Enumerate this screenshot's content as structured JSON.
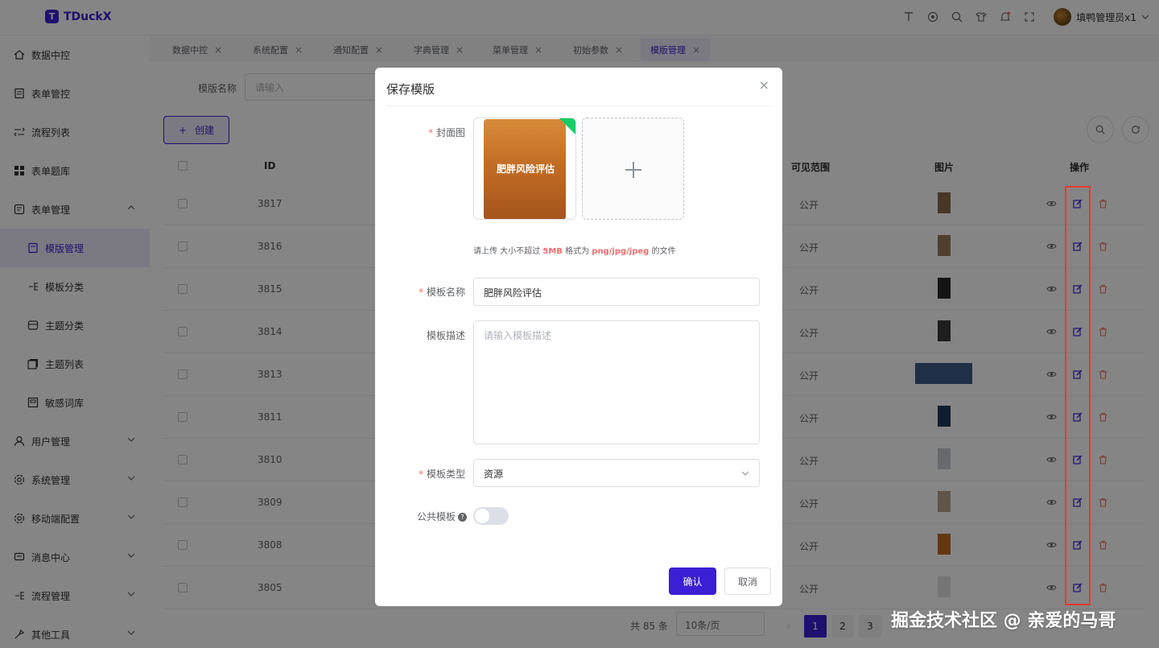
{
  "app": {
    "name": "TDuckX",
    "logo_letter": "T"
  },
  "topbar": {
    "icons": [
      "text-icon",
      "target-icon",
      "search-icon",
      "shirt-icon",
      "bell-icon",
      "fullscreen-icon"
    ],
    "user": "填鸭管理员x1"
  },
  "sidebar": {
    "items": [
      {
        "label": "数据中控",
        "icon": "home-icon"
      },
      {
        "label": "表单管控",
        "icon": "form-icon"
      },
      {
        "label": "流程列表",
        "icon": "flow-icon"
      },
      {
        "label": "表单题库",
        "icon": "grid-icon"
      },
      {
        "label": "表单管理",
        "icon": "form-manage-icon"
      },
      {
        "label": "模版管理",
        "icon": "template-icon"
      },
      {
        "label": "模板分类",
        "icon": "category-icon"
      },
      {
        "label": "主题分类",
        "icon": "theme-icon"
      },
      {
        "label": "主题列表",
        "icon": "list-icon"
      },
      {
        "label": "敏感词库",
        "icon": "word-icon"
      },
      {
        "label": "用户管理",
        "icon": "user-icon"
      },
      {
        "label": "系统管理",
        "icon": "settings-icon"
      },
      {
        "label": "移动端配置",
        "icon": "mobile-icon"
      },
      {
        "label": "消息中心",
        "icon": "message-icon"
      },
      {
        "label": "流程管理",
        "icon": "process-icon"
      },
      {
        "label": "其他工具",
        "icon": "tool-icon"
      }
    ]
  },
  "tabs": [
    {
      "label": "数据中控"
    },
    {
      "label": "系统配置"
    },
    {
      "label": "通知配置"
    },
    {
      "label": "字典管理"
    },
    {
      "label": "菜单管理"
    },
    {
      "label": "初始参数"
    },
    {
      "label": "模版管理"
    }
  ],
  "search": {
    "label": "模版名称",
    "placeholder": "请输入"
  },
  "toolbar": {
    "create_label": "创建",
    "create_icon": "+"
  },
  "table": {
    "headers": {
      "id": "ID",
      "scope": "可见范围",
      "image": "图片",
      "ops": "操作"
    },
    "rows": [
      {
        "id": "3817",
        "scope": "公开"
      },
      {
        "id": "3816",
        "scope": "公开"
      },
      {
        "id": "3815",
        "scope": "公开"
      },
      {
        "id": "3814",
        "scope": "公开"
      },
      {
        "id": "3813",
        "scope": "公开"
      },
      {
        "id": "3811",
        "scope": "公开"
      },
      {
        "id": "3810",
        "scope": "公开"
      },
      {
        "id": "3809",
        "scope": "公开"
      },
      {
        "id": "3808",
        "scope": "公开"
      },
      {
        "id": "3805",
        "scope": "公开"
      }
    ]
  },
  "pagination": {
    "total": "共 85 条",
    "size": "10条/页",
    "pages": [
      "1",
      "2",
      "3"
    ],
    "current": "1"
  },
  "watermark": "掘金技术社区 @ 亲爱的马哥",
  "modal": {
    "title": "保存模版",
    "close": "×",
    "cover_label": "封面图",
    "cover_text": "肥胖风险评估",
    "upload_plus": "+",
    "hint_pre": "请上传 大小不超过",
    "hint_size": "5MB",
    "hint_mid": "格式为",
    "hint_fmt": "png/jpg/jpeg",
    "hint_post": "的文件",
    "name_label": "模板名称",
    "name_value": "肥胖风险评估",
    "desc_label": "模板描述",
    "desc_placeholder": "请输入模板描述",
    "type_label": "模板类型",
    "type_value": "资源",
    "public_label": "公共模板",
    "public_help": "?",
    "public_on": false,
    "required_mark": "*",
    "ok": "确认",
    "cancel": "取消"
  },
  "colors": {
    "primary": "#3b1fd4",
    "danger": "#f56c6c",
    "highlight_box": "#e83a2f"
  }
}
